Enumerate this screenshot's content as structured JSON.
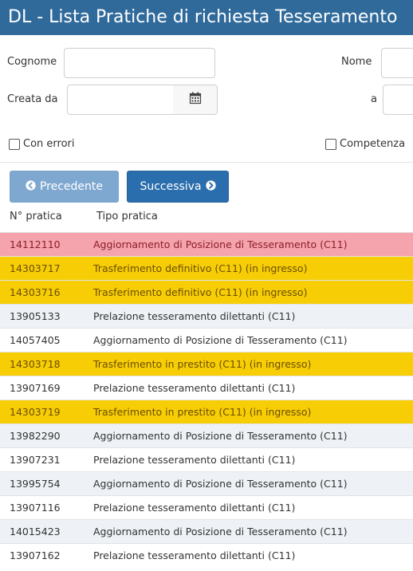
{
  "page": {
    "title": "DL - Lista Pratiche di richiesta Tesseramento"
  },
  "filters": {
    "cognome_label": "Cognome",
    "cognome_value": "",
    "nome_label": "Nome",
    "nome_value": "",
    "creata_da_label": "Creata da",
    "creata_da_value": "",
    "a_label": "a",
    "a_value": "",
    "con_errori_label": "Con errori",
    "competenza_label": "Competenza"
  },
  "pager": {
    "prev_label": "Precedente",
    "next_label": "Successiva"
  },
  "table": {
    "headers": [
      "N° pratica",
      "Tipo pratica"
    ],
    "rows": [
      {
        "id": "14112110",
        "tipo": "Aggiornamento di Posizione di Tesseramento (C11)",
        "status": "red"
      },
      {
        "id": "14303717",
        "tipo": "Trasferimento definitivo (C11) (in ingresso)",
        "status": "yellow"
      },
      {
        "id": "14303716",
        "tipo": "Trasferimento definitivo (C11) (in ingresso)",
        "status": "yellow"
      },
      {
        "id": "13905133",
        "tipo": "Prelazione tesseramento dilettanti (C11)",
        "status": "alt"
      },
      {
        "id": "14057405",
        "tipo": "Aggiornamento di Posizione di Tesseramento (C11)",
        "status": "plain"
      },
      {
        "id": "14303718",
        "tipo": "Trasferimento in prestito (C11) (in ingresso)",
        "status": "yellow"
      },
      {
        "id": "13907169",
        "tipo": "Prelazione tesseramento dilettanti (C11)",
        "status": "plain"
      },
      {
        "id": "14303719",
        "tipo": "Trasferimento in prestito (C11) (in ingresso)",
        "status": "yellow"
      },
      {
        "id": "13982290",
        "tipo": "Aggiornamento di Posizione di Tesseramento (C11)",
        "status": "alt"
      },
      {
        "id": "13907231",
        "tipo": "Prelazione tesseramento dilettanti (C11)",
        "status": "plain"
      },
      {
        "id": "13995754",
        "tipo": "Aggiornamento di Posizione di Tesseramento (C11)",
        "status": "alt"
      },
      {
        "id": "13907116",
        "tipo": "Prelazione tesseramento dilettanti (C11)",
        "status": "plain"
      },
      {
        "id": "14015423",
        "tipo": "Aggiornamento di Posizione di Tesseramento (C11)",
        "status": "alt"
      },
      {
        "id": "13907162",
        "tipo": "Prelazione tesseramento dilettanti (C11)",
        "status": "plain"
      }
    ]
  },
  "colors": {
    "title_bg": "#2f6a9b",
    "error_row": "#f5a3ad",
    "incoming_row": "#f7cd06",
    "alt_row": "#eef2f6",
    "prev_button": "#7fa8d0",
    "next_button": "#2b6ead"
  },
  "icons": {
    "calendar": "calendar-icon",
    "prev": "arrow-left-circle-icon",
    "next": "arrow-right-circle-icon"
  }
}
